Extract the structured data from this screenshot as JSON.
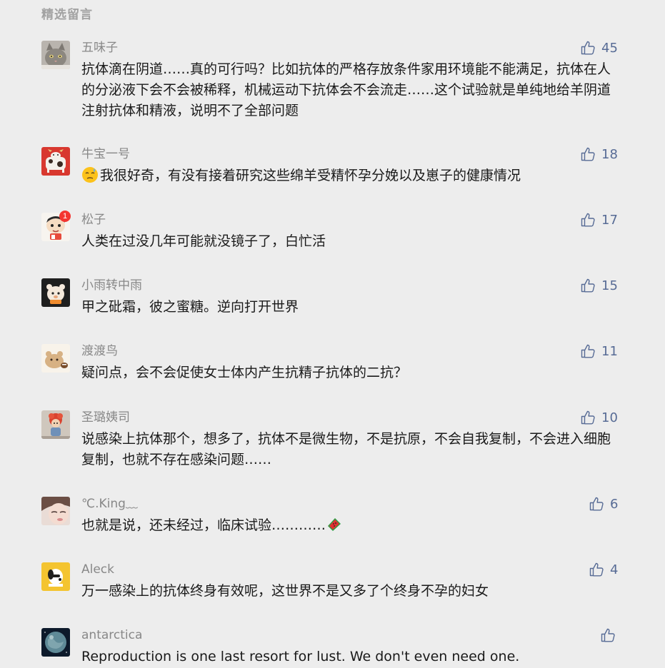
{
  "section": {
    "title": "精选留言"
  },
  "comments": [
    {
      "nickname": "五味子",
      "likes": "45",
      "content": "抗体滴在阴道……真的可行吗？比如抗体的严格存放条件家用环境能不能满足，抗体在人的分泌液下会不会被稀释，机械运动下抗体会不会流走……这个试验就是单纯地给羊阴道注射抗体和精液，说明不了全部问题"
    },
    {
      "nickname": "牛宝一号",
      "likes": "18",
      "content": "我很好奇，有没有接着研究这些绵羊受精怀孕分娩以及崽子的健康情况"
    },
    {
      "nickname": "松子",
      "likes": "17",
      "badge": "1",
      "content": "人类在过没几年可能就没镜子了，白忙活"
    },
    {
      "nickname": "小雨转中雨",
      "likes": "15",
      "content": "甲之砒霜，彼之蜜糖。逆向打开世界"
    },
    {
      "nickname": "渡渡鸟",
      "likes": "11",
      "content": "疑问点，会不会促使女士体内产生抗精子抗体的二抗？"
    },
    {
      "nickname": "圣璐姨司",
      "likes": "10",
      "content": "说感染上抗体那个，想多了，抗体不是微生物，不是抗原，不会自我复制，不会进入细胞复制，也就不存在感染问题……"
    },
    {
      "nickname": "℃.King﹏",
      "likes": "6",
      "content": "也就是说，还未经过，临床试验…………"
    },
    {
      "nickname": "Aleck",
      "likes": "4",
      "content": "万一感染上的抗体终身有效呢，这世界不是又多了个终身不孕的妇女"
    },
    {
      "nickname": "antarctica",
      "likes": "",
      "content": "Reproduction is one last resort for lust. We don't even need one."
    }
  ],
  "colors": {
    "background": "#ededed",
    "nickname": "#888888",
    "like": "#576b95",
    "content": "#1a1a1a",
    "badge": "#f43530"
  }
}
